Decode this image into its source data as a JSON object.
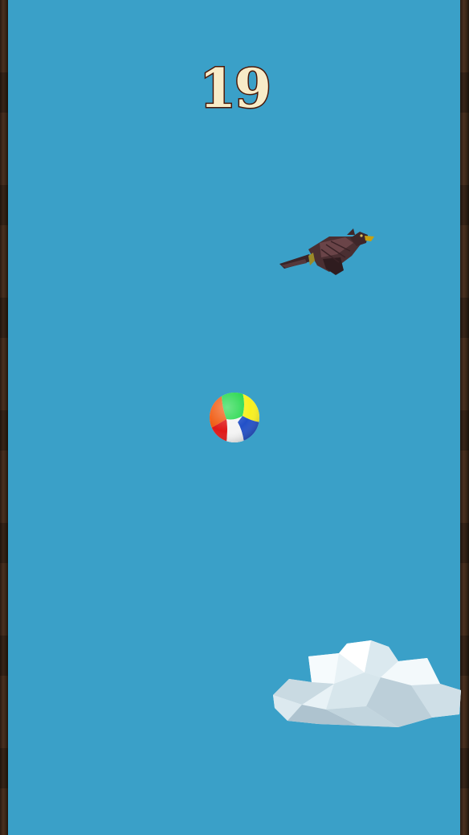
{
  "hud": {
    "score": "19"
  },
  "scene": {
    "sky_color": "#3aa0c8",
    "wall_color": "#3b2616",
    "ball_colors": [
      "#f04a10",
      "#22d84a",
      "#f8f020",
      "#2250c8",
      "#e01818",
      "#f4f4f4"
    ],
    "bird_color": "#4a2f32",
    "cloud_color": "#eef6fa"
  }
}
